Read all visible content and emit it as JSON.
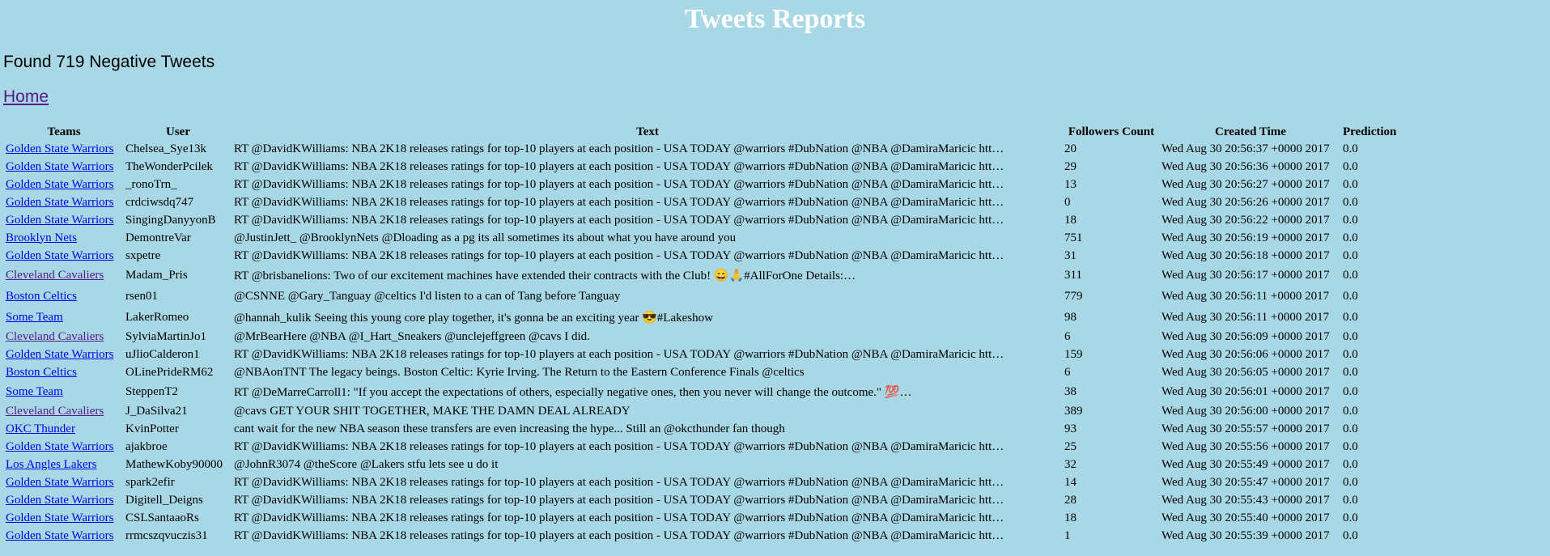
{
  "page": {
    "title": "Tweets Reports",
    "summary": "Found 719 Negative Tweets",
    "home_link": "Home"
  },
  "table": {
    "headers": {
      "teams": "Teams",
      "user": "User",
      "text": "Text",
      "followers": "Followers Count",
      "created": "Created Time",
      "prediction": "Prediction"
    },
    "rows": [
      {
        "team": "Golden State Warriors",
        "user": "Chelsea_Sye13k",
        "text": "RT @DavidKWilliams: NBA 2K18 releases ratings for top-10 players at each position - USA TODAY @warriors #DubNation @NBA @DamiraMaricic htt…",
        "followers": "20",
        "created": "Wed Aug 30 20:56:37 +0000 2017",
        "prediction": "0.0"
      },
      {
        "team": "Golden State Warriors",
        "user": "TheWonderPcilek",
        "text": "RT @DavidKWilliams: NBA 2K18 releases ratings for top-10 players at each position - USA TODAY @warriors #DubNation @NBA @DamiraMaricic htt…",
        "followers": "29",
        "created": "Wed Aug 30 20:56:36 +0000 2017",
        "prediction": "0.0"
      },
      {
        "team": "Golden State Warriors",
        "user": "_ronoTrn_",
        "text": "RT @DavidKWilliams: NBA 2K18 releases ratings for top-10 players at each position - USA TODAY @warriors #DubNation @NBA @DamiraMaricic htt…",
        "followers": "13",
        "created": "Wed Aug 30 20:56:27 +0000 2017",
        "prediction": "0.0"
      },
      {
        "team": "Golden State Warriors",
        "user": "crdciwsdq747",
        "text": "RT @DavidKWilliams: NBA 2K18 releases ratings for top-10 players at each position - USA TODAY @warriors #DubNation @NBA @DamiraMaricic htt…",
        "followers": "0",
        "created": "Wed Aug 30 20:56:26 +0000 2017",
        "prediction": "0.0"
      },
      {
        "team": "Golden State Warriors",
        "user": "SingingDanyyonB",
        "text": "RT @DavidKWilliams: NBA 2K18 releases ratings for top-10 players at each position - USA TODAY @warriors #DubNation @NBA @DamiraMaricic htt…",
        "followers": "18",
        "created": "Wed Aug 30 20:56:22 +0000 2017",
        "prediction": "0.0"
      },
      {
        "team": "Brooklyn Nets",
        "user": "DemontreVar",
        "text": "@JustinJett_ @BrooklynNets @Dloading as a pg its all sometimes its about what you have around you",
        "followers": "751",
        "created": "Wed Aug 30 20:56:19 +0000 2017",
        "prediction": "0.0"
      },
      {
        "team": "Golden State Warriors",
        "user": "sxpetre",
        "text": "RT @DavidKWilliams: NBA 2K18 releases ratings for top-10 players at each position - USA TODAY @warriors #DubNation @NBA @DamiraMaricic htt…",
        "followers": "31",
        "created": "Wed Aug 30 20:56:18 +0000 2017",
        "prediction": "0.0"
      },
      {
        "team": "Cleveland Cavaliers",
        "user": "Madam_Pris",
        "text": "RT @brisbanelions: Two of our excitement machines have extended their contracts with the Club! 😄🙏#AllForOne Details:…",
        "followers": "311",
        "created": "Wed Aug 30 20:56:17 +0000 2017",
        "prediction": "0.0",
        "visited": true,
        "tall": true
      },
      {
        "team": "Boston Celtics",
        "user": "rsen01",
        "text": "@CSNNE @Gary_Tanguay @celtics I'd listen to a can of Tang before Tanguay",
        "followers": "779",
        "created": "Wed Aug 30 20:56:11 +0000 2017",
        "prediction": "0.0",
        "tall": true
      },
      {
        "team": "Some Team",
        "user": "LakerRomeo",
        "text": "@hannah_kulik Seeing this young core play together, it's gonna be an exciting year 😎#Lakeshow",
        "followers": "98",
        "created": "Wed Aug 30 20:56:11 +0000 2017",
        "prediction": "0.0",
        "tall": true
      },
      {
        "team": "Cleveland Cavaliers",
        "user": "SylviaMartinJo1",
        "text": "@MrBearHere @NBA @I_Hart_Sneakers @unclejeffgreen @cavs I did.",
        "followers": "6",
        "created": "Wed Aug 30 20:56:09 +0000 2017",
        "prediction": "0.0",
        "visited": true
      },
      {
        "team": "Golden State Warriors",
        "user": "uJlioCalderon1",
        "text": "RT @DavidKWilliams: NBA 2K18 releases ratings for top-10 players at each position - USA TODAY @warriors #DubNation @NBA @DamiraMaricic htt…",
        "followers": "159",
        "created": "Wed Aug 30 20:56:06 +0000 2017",
        "prediction": "0.0"
      },
      {
        "team": "Boston Celtics",
        "user": "OLinePrideRM62",
        "text": "@NBAonTNT The legacy beings. Boston Celtic: Kyrie Irving. The Return to the Eastern Conference Finals @celtics",
        "followers": "6",
        "created": "Wed Aug 30 20:56:05 +0000 2017",
        "prediction": "0.0"
      },
      {
        "team": "Some Team",
        "user": "SteppenT2",
        "text": "RT @DeMarreCarroll1: \"If you accept the expectations of others, especially negative ones, then you never will change the outcome.\" 💯…",
        "followers": "38",
        "created": "Wed Aug 30 20:56:01 +0000 2017",
        "prediction": "0.0",
        "tall": true
      },
      {
        "team": "Cleveland Cavaliers",
        "user": "J_DaSilva21",
        "text": "@cavs GET YOUR SHIT TOGETHER, MAKE THE DAMN DEAL ALREADY",
        "followers": "389",
        "created": "Wed Aug 30 20:56:00 +0000 2017",
        "prediction": "0.0",
        "visited": true
      },
      {
        "team": "OKC Thunder",
        "user": "KvinPotter",
        "text": "cant wait for the new NBA season these transfers are even increasing the hype... Still an @okcthunder fan though",
        "followers": "93",
        "created": "Wed Aug 30 20:55:57 +0000 2017",
        "prediction": "0.0"
      },
      {
        "team": "Golden State Warriors",
        "user": "ajakbroe",
        "text": "RT @DavidKWilliams: NBA 2K18 releases ratings for top-10 players at each position - USA TODAY @warriors #DubNation @NBA @DamiraMaricic htt…",
        "followers": "25",
        "created": "Wed Aug 30 20:55:56 +0000 2017",
        "prediction": "0.0"
      },
      {
        "team": "Los Angles Lakers",
        "user": "MathewKoby90000",
        "text": "@JohnR3074 @theScore @Lakers stfu lets see u do it",
        "followers": "32",
        "created": "Wed Aug 30 20:55:49 +0000 2017",
        "prediction": "0.0"
      },
      {
        "team": "Golden State Warriors",
        "user": "spark2efir",
        "text": "RT @DavidKWilliams: NBA 2K18 releases ratings for top-10 players at each position - USA TODAY @warriors #DubNation @NBA @DamiraMaricic htt…",
        "followers": "14",
        "created": "Wed Aug 30 20:55:47 +0000 2017",
        "prediction": "0.0"
      },
      {
        "team": "Golden State Warriors",
        "user": "Digitell_Deigns",
        "text": "RT @DavidKWilliams: NBA 2K18 releases ratings for top-10 players at each position - USA TODAY @warriors #DubNation @NBA @DamiraMaricic htt…",
        "followers": "28",
        "created": "Wed Aug 30 20:55:43 +0000 2017",
        "prediction": "0.0"
      },
      {
        "team": "Golden State Warriors",
        "user": "CSLSantaaoRs",
        "text": "RT @DavidKWilliams: NBA 2K18 releases ratings for top-10 players at each position - USA TODAY @warriors #DubNation @NBA @DamiraMaricic htt…",
        "followers": "18",
        "created": "Wed Aug 30 20:55:40 +0000 2017",
        "prediction": "0.0"
      },
      {
        "team": "Golden State Warriors",
        "user": "rrmcszqvuczis31",
        "text": "RT @DavidKWilliams: NBA 2K18 releases ratings for top-10 players at each position - USA TODAY @warriors #DubNation @NBA @DamiraMaricic htt…",
        "followers": "1",
        "created": "Wed Aug 30 20:55:39 +0000 2017",
        "prediction": "0.0"
      }
    ]
  },
  "colors": {
    "background": "#a8d8e6",
    "title": "#ffffff",
    "link": "#0000ee",
    "visited_link": "#551a8b"
  }
}
